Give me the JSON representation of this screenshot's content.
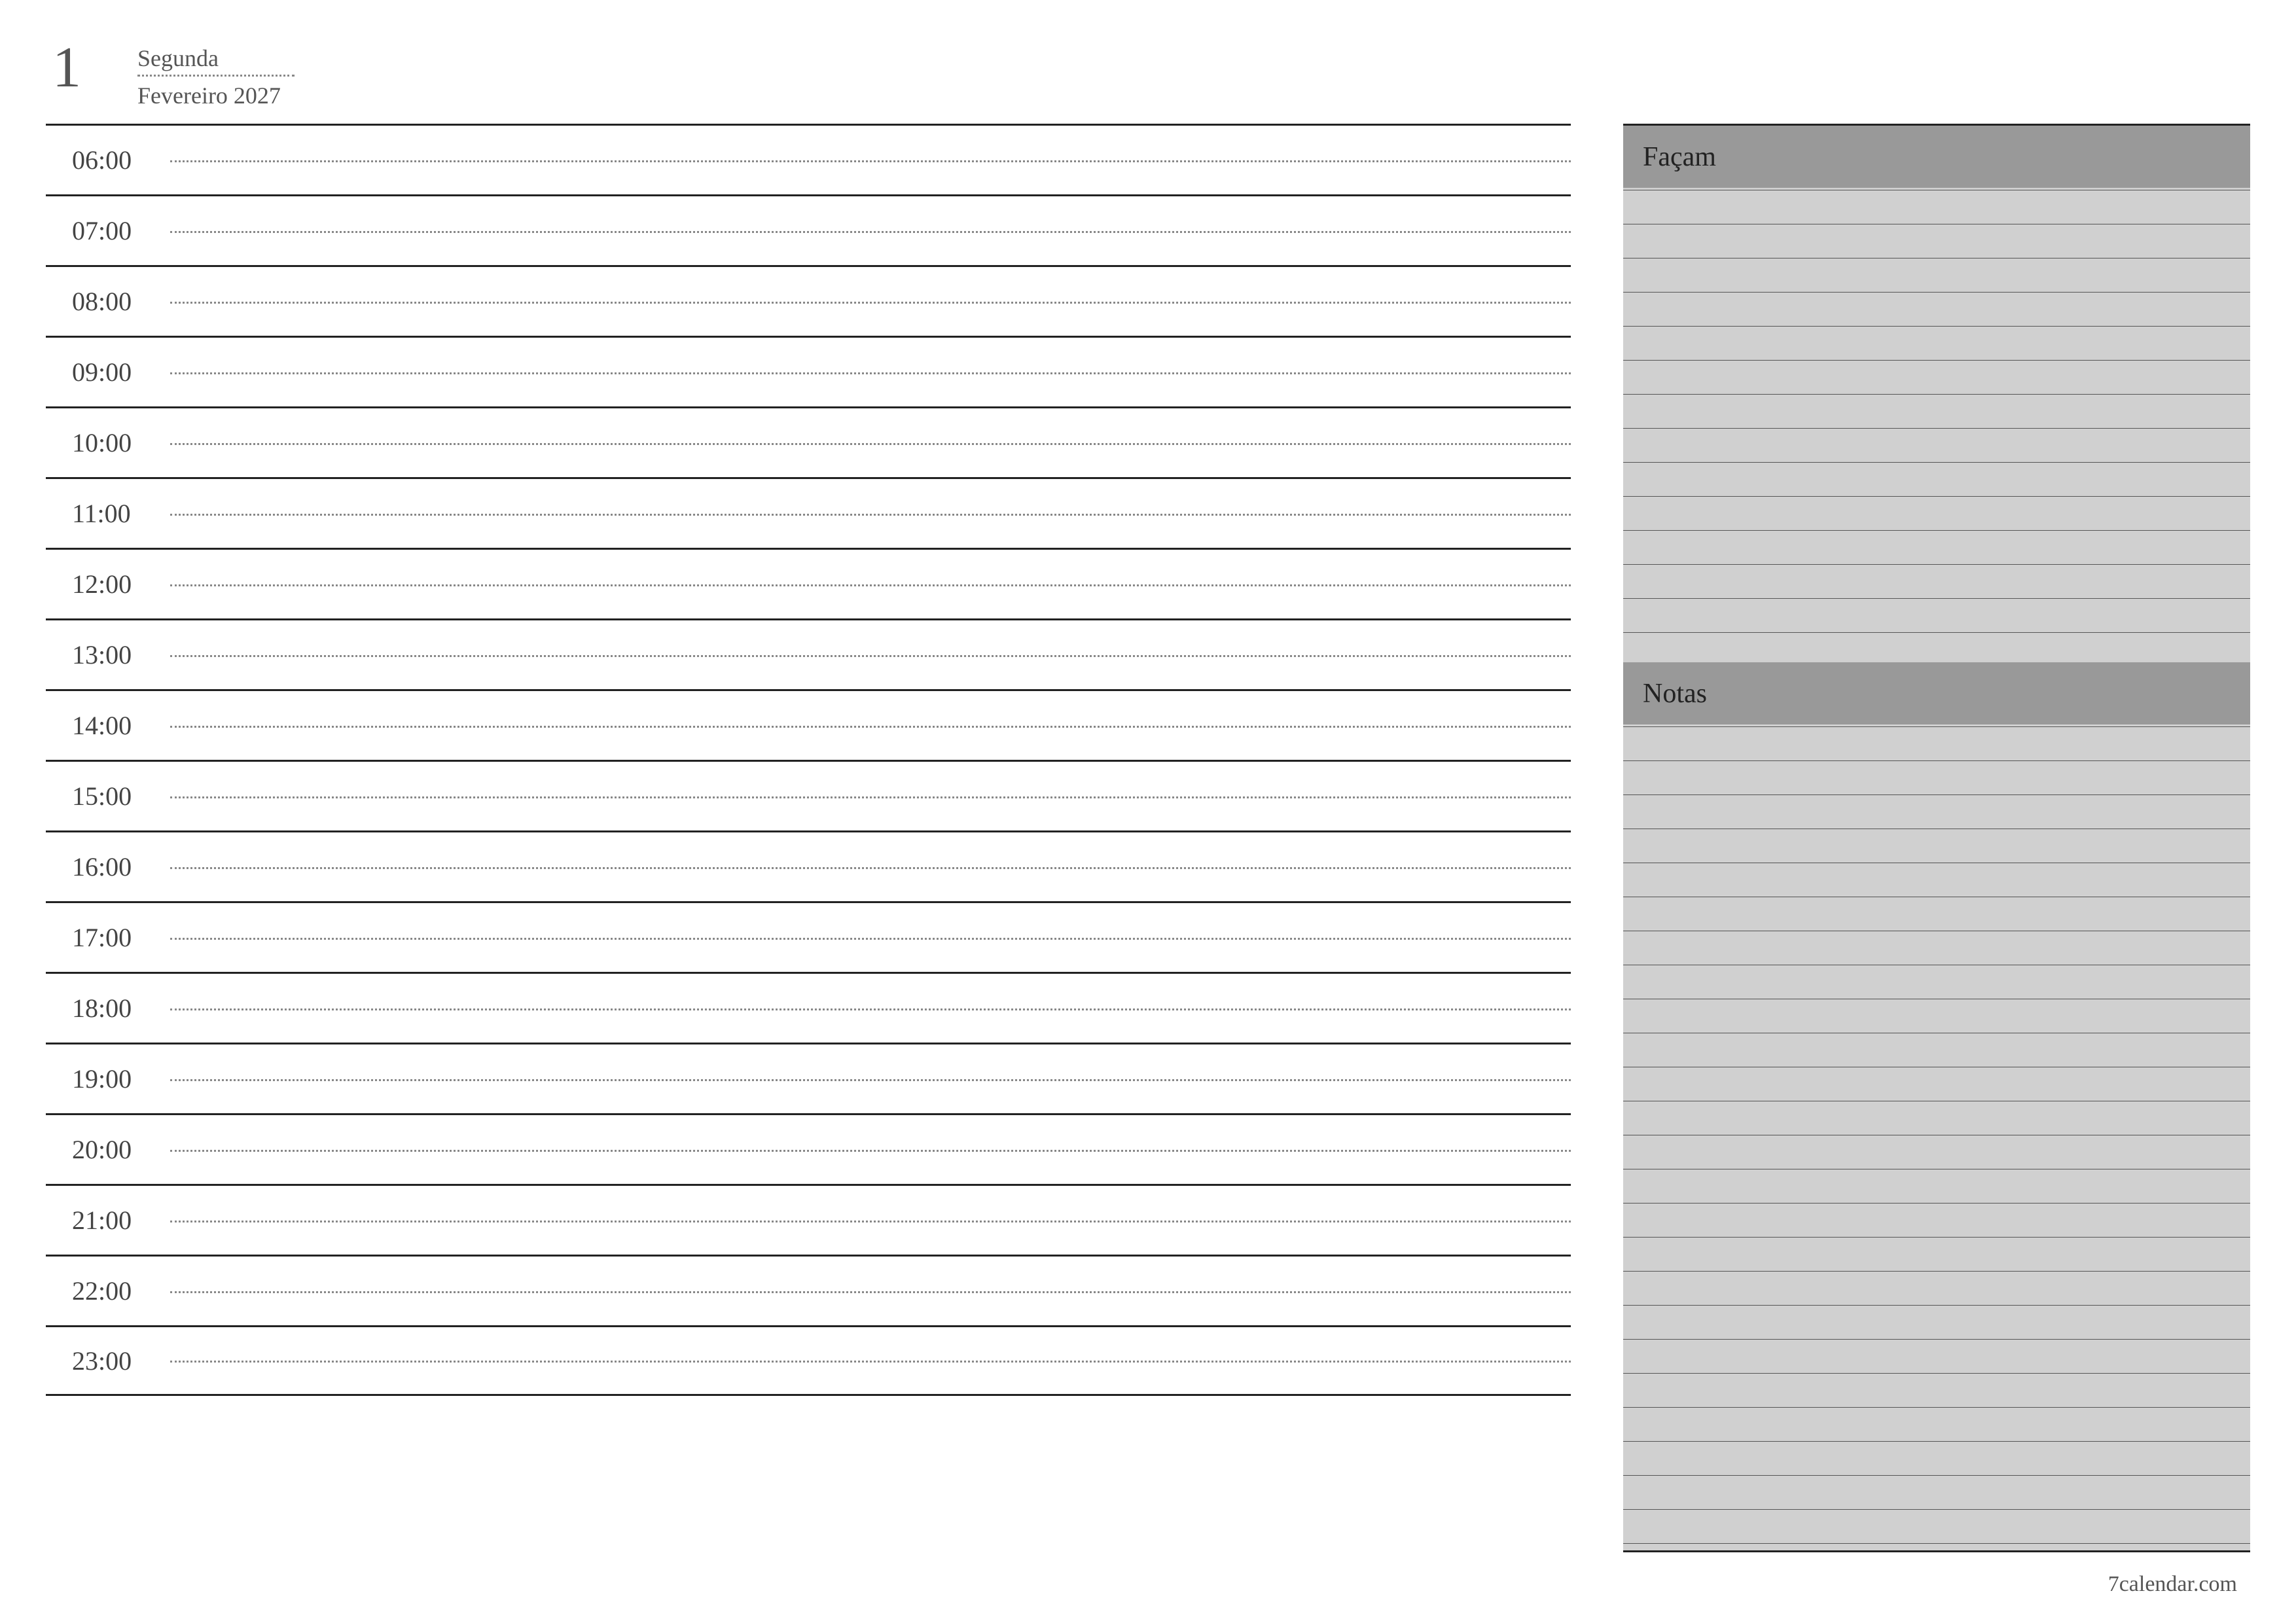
{
  "header": {
    "day_number": "1",
    "day_name": "Segunda",
    "month_year": "Fevereiro 2027"
  },
  "schedule": {
    "hours": [
      "06:00",
      "07:00",
      "08:00",
      "09:00",
      "10:00",
      "11:00",
      "12:00",
      "13:00",
      "14:00",
      "15:00",
      "16:00",
      "17:00",
      "18:00",
      "19:00",
      "20:00",
      "21:00",
      "22:00",
      "23:00"
    ]
  },
  "sidebar": {
    "todo_label": "Façam",
    "notes_label": "Notas"
  },
  "footer": {
    "site": "7calendar.com"
  }
}
